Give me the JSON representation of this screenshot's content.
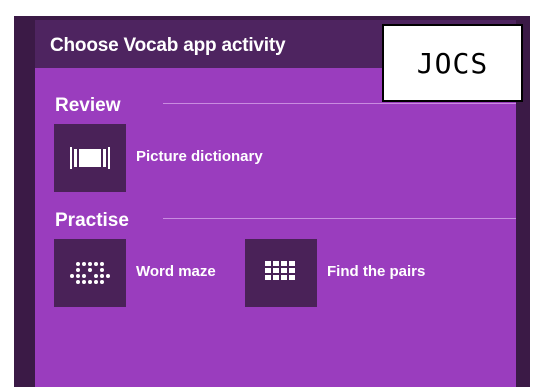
{
  "header": {
    "title": "Choose Vocab app activity"
  },
  "overlay_label": "JOCS",
  "sections": {
    "review": {
      "title": "Review",
      "activities": [
        {
          "label": "Picture dictionary",
          "icon": "picture-dictionary-icon"
        }
      ]
    },
    "practise": {
      "title": "Practise",
      "activities": [
        {
          "label": "Word maze",
          "icon": "word-maze-icon"
        },
        {
          "label": "Find the pairs",
          "icon": "find-the-pairs-icon"
        }
      ]
    }
  },
  "colors": {
    "panel": "#9a3dbe",
    "header": "#4e2460",
    "tile": "#4a2258",
    "frame": "#3b1a46"
  }
}
